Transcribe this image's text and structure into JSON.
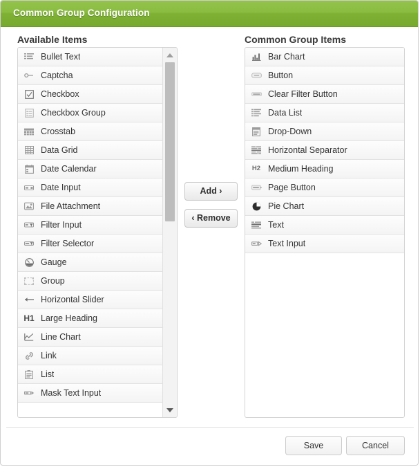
{
  "window": {
    "title": "Common Group Configuration",
    "accent_color": "#8bbc42"
  },
  "available_panel": {
    "header": "Available Items",
    "items": [
      {
        "label": "Bullet Text",
        "icon": "bullet-text-icon"
      },
      {
        "label": "Captcha",
        "icon": "captcha-icon"
      },
      {
        "label": "Checkbox",
        "icon": "checkbox-icon"
      },
      {
        "label": "Checkbox Group",
        "icon": "checkbox-group-icon"
      },
      {
        "label": "Crosstab",
        "icon": "crosstab-icon"
      },
      {
        "label": "Data Grid",
        "icon": "data-grid-icon"
      },
      {
        "label": "Date Calendar",
        "icon": "date-calendar-icon"
      },
      {
        "label": "Date Input",
        "icon": "date-input-icon"
      },
      {
        "label": "File Attachment",
        "icon": "file-attachment-icon"
      },
      {
        "label": "Filter Input",
        "icon": "filter-input-icon"
      },
      {
        "label": "Filter Selector",
        "icon": "filter-selector-icon"
      },
      {
        "label": "Gauge",
        "icon": "gauge-icon"
      },
      {
        "label": "Group",
        "icon": "group-icon"
      },
      {
        "label": "Horizontal Slider",
        "icon": "horizontal-slider-icon"
      },
      {
        "label": "Large Heading",
        "icon": "h1-icon"
      },
      {
        "label": "Line Chart",
        "icon": "line-chart-icon"
      },
      {
        "label": "Link",
        "icon": "link-icon"
      },
      {
        "label": "List",
        "icon": "list-icon"
      },
      {
        "label": "Mask Text Input",
        "icon": "mask-text-input-icon"
      }
    ]
  },
  "selected_panel": {
    "header": "Common Group Items",
    "items": [
      {
        "label": "Bar Chart",
        "icon": "bar-chart-icon"
      },
      {
        "label": "Button",
        "icon": "button-icon"
      },
      {
        "label": "Clear Filter Button",
        "icon": "clear-filter-button-icon"
      },
      {
        "label": "Data List",
        "icon": "data-list-icon"
      },
      {
        "label": "Drop-Down",
        "icon": "drop-down-icon"
      },
      {
        "label": "Horizontal Separator",
        "icon": "horizontal-separator-icon"
      },
      {
        "label": "Medium Heading",
        "icon": "h2-icon"
      },
      {
        "label": "Page Button",
        "icon": "page-button-icon"
      },
      {
        "label": "Pie Chart",
        "icon": "pie-chart-icon"
      },
      {
        "label": "Text",
        "icon": "text-icon"
      },
      {
        "label": "Text Input",
        "icon": "text-input-icon"
      }
    ]
  },
  "transfer_buttons": {
    "add_label": "Add ›",
    "remove_label": "‹ Remove"
  },
  "footer": {
    "save_label": "Save",
    "cancel_label": "Cancel"
  }
}
